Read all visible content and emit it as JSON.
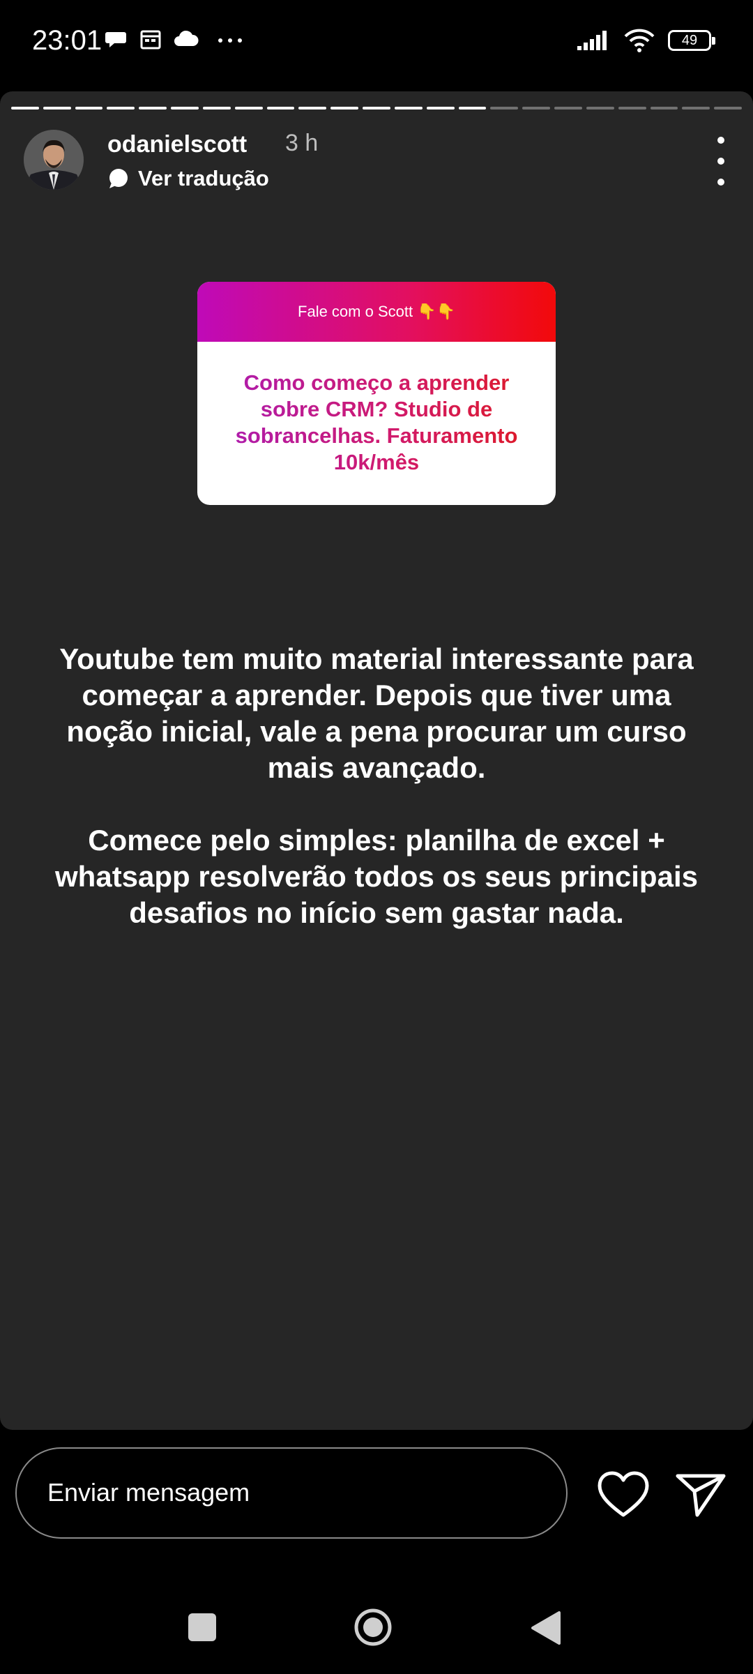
{
  "status_bar": {
    "time": "23:01",
    "battery": "49",
    "left_icons": [
      "chat-bubble-icon",
      "calendar-icon",
      "cloud-icon",
      "more-dots-icon"
    ],
    "right_icons": [
      "signal-icon",
      "wifi-icon",
      "battery-icon"
    ]
  },
  "story": {
    "progress": {
      "segments": 23,
      "viewed": 15
    },
    "username": "odanielscott",
    "time_ago": "3 h",
    "translate_label": "Ver tradução",
    "question_box": {
      "header": "Fale com o Scott 👇👇",
      "question": "Como começo a aprender sobre CRM? Studio de sobrancelhas. Faturamento 10k/mês"
    },
    "answer_paragraph_1": "Youtube tem muito material interessante para começar a aprender. Depois que tiver uma noção inicial, vale a pena procurar um curso mais avançado.",
    "answer_paragraph_2": "Comece pelo simples: planilha de excel + whatsapp resolverão todos os seus principais desafios no início sem gastar nada."
  },
  "reply_bar": {
    "placeholder": "Enviar mensagem",
    "icons": [
      "heart-icon",
      "send-icon"
    ]
  },
  "nav_bar": {
    "icons": [
      "recents-icon",
      "home-icon",
      "back-icon"
    ]
  },
  "colors": {
    "story_background": "#262626",
    "sticker_gradient_start": "#bf0ab8",
    "sticker_gradient_end": "#f20a0a"
  }
}
